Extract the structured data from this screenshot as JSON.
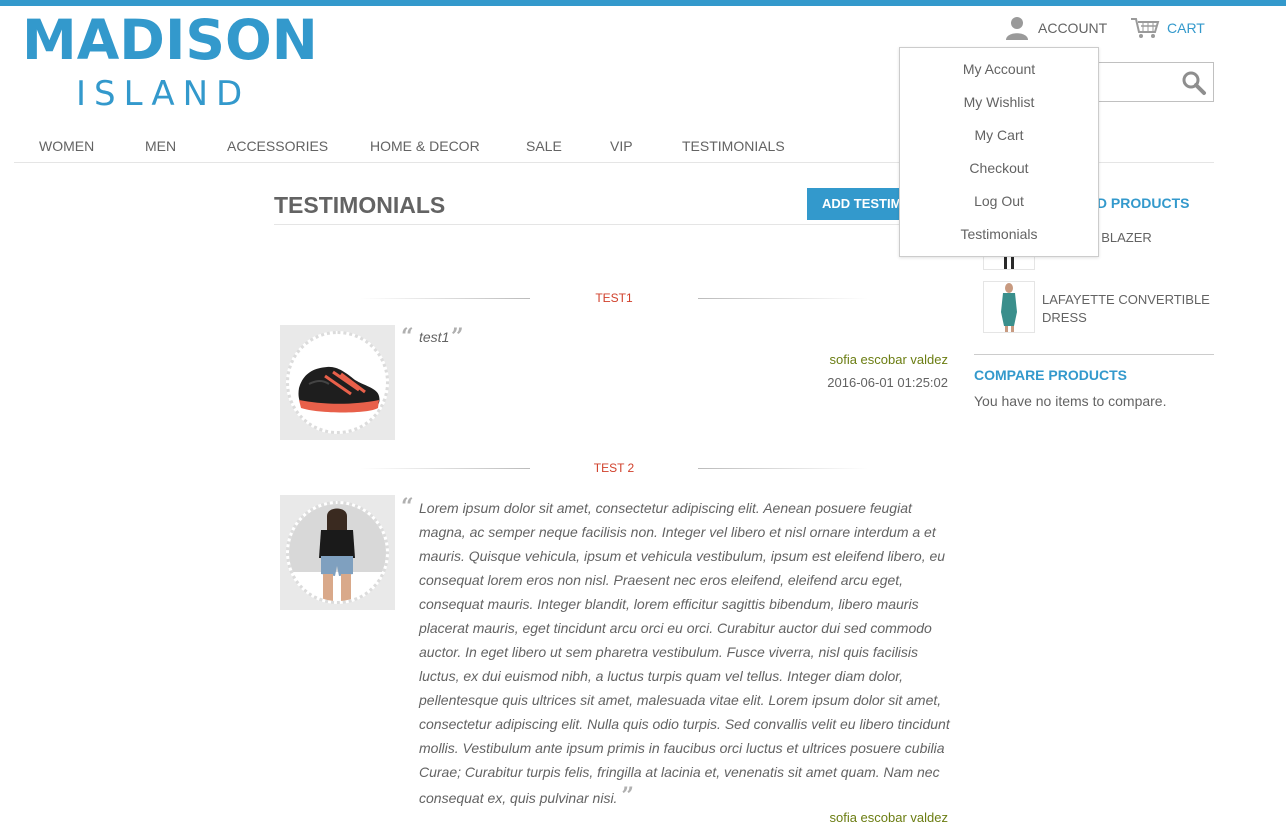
{
  "brand": {
    "name_main": "MADISON",
    "name_sub": "ISLAND",
    "color": "#3399cc"
  },
  "header": {
    "account_label": "ACCOUNT",
    "cart_label": "CART",
    "search_placeholder": ""
  },
  "account_menu": {
    "items": [
      "My Account",
      "My Wishlist",
      "My Cart",
      "Checkout",
      "Log Out",
      "Testimonials"
    ]
  },
  "nav": {
    "items": [
      "WOMEN",
      "MEN",
      "ACCESSORIES",
      "HOME & DECOR",
      "SALE",
      "VIP",
      "TESTIMONIALS"
    ]
  },
  "main": {
    "page_title": "TESTIMONIALS",
    "add_button": "ADD TESTIMONIAL",
    "testimonials": [
      {
        "title": "TEST1",
        "quote": "test1",
        "author": "sofia escobar valdez",
        "date": "2016-06-01 01:25:02",
        "image": "shoe-image"
      },
      {
        "title": "TEST 2",
        "quote": "Lorem ipsum dolor sit amet, consectetur adipiscing elit. Aenean posuere feugiat magna, ac semper neque facilisis non. Integer vel libero et nisl ornare interdum a et mauris. Quisque vehicula, ipsum et vehicula vestibulum, ipsum est eleifend libero, eu consequat lorem eros non nisl. Praesent nec eros eleifend, eleifend arcu eget, consequat mauris. Integer blandit, lorem efficitur sagittis bibendum, libero mauris placerat mauris, eget tincidunt arcu orci eu orci. Curabitur auctor dui sed commodo auctor. In eget libero ut sem pharetra vestibulum. Fusce viverra, nisl quis facilisis luctus, ex dui euismod nibh, a luctus turpis quam vel tellus. Integer diam dolor, pellentesque quis ultrices sit amet, malesuada vitae elit. Lorem ipsum dolor sit amet, consectetur adipiscing elit. Nulla quis odio turpis. Sed convallis velit eu libero tincidunt mollis. Vestibulum ante ipsum primis in faucibus orci luctus et ultrices posuere cubilia Curae; Curabitur turpis felis, fringilla at lacinia et, venenatis sit amet quam. Nam nec consequat ex, quis pulvinar nisi.",
        "author": "sofia escobar valdez",
        "image": "woman-image"
      }
    ]
  },
  "sidebar": {
    "recent_title": "RECENTLY VIEWED PRODUCTS",
    "recent_products": [
      "TRIBECA BLAZER",
      "LAFAYETTE CONVERTIBLE DRESS"
    ],
    "compare_title": "COMPARE PRODUCTS",
    "compare_empty": "You have no items to compare."
  },
  "colors": {
    "accent": "#3399cc",
    "section_label": "#d0402b",
    "author": "#6b7d12",
    "text": "#636363"
  }
}
